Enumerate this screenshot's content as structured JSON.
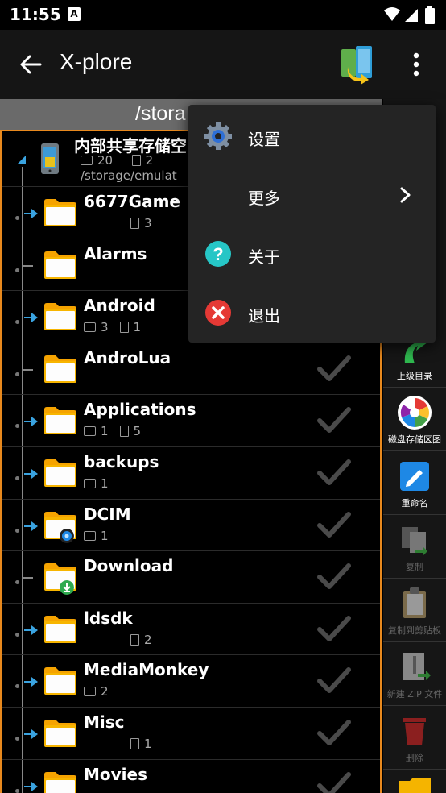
{
  "status_bar": {
    "time": "11:55",
    "badge": "A"
  },
  "action_bar": {
    "title": "X-plore"
  },
  "path_bar": {
    "path": "/stora"
  },
  "storage": {
    "name": "内部共享存储空",
    "folders": "20",
    "files": "2",
    "path": "/storage/emulat"
  },
  "rows": [
    {
      "name": "6677Game",
      "folders": "",
      "files": "3",
      "expandable": true,
      "checked": false
    },
    {
      "name": "Alarms",
      "folders": "",
      "files": "",
      "expandable": false,
      "checked": false
    },
    {
      "name": "Android",
      "folders": "3",
      "files": "1",
      "expandable": true,
      "checked": false
    },
    {
      "name": "AndroLua",
      "folders": "",
      "files": "",
      "expandable": false,
      "checked": true
    },
    {
      "name": "Applications",
      "folders": "1",
      "files": "5",
      "expandable": true,
      "checked": true
    },
    {
      "name": "backups",
      "folders": "1",
      "files": "",
      "expandable": true,
      "checked": true
    },
    {
      "name": "DCIM",
      "folders": "1",
      "files": "",
      "expandable": true,
      "checked": true
    },
    {
      "name": "Download",
      "folders": "",
      "files": "",
      "expandable": false,
      "checked": true
    },
    {
      "name": "ldsdk",
      "folders": "",
      "files": "2",
      "expandable": true,
      "checked": true
    },
    {
      "name": "MediaMonkey",
      "folders": "2",
      "files": "",
      "expandable": true,
      "checked": true
    },
    {
      "name": "Misc",
      "folders": "",
      "files": "1",
      "expandable": true,
      "checked": true
    },
    {
      "name": "Movies",
      "folders": "",
      "files": "",
      "expandable": true,
      "checked": true
    }
  ],
  "toolbar": {
    "parent_dir": "上级目录",
    "disk_map": "磁盘存储区图",
    "rename": "重命名",
    "copy": "复制",
    "copy_clipboard": "复制到剪贴板",
    "new_zip": "新建 ZIP 文件",
    "delete": "删除"
  },
  "menu": {
    "settings": "设置",
    "more": "更多",
    "about": "关于",
    "exit": "退出"
  },
  "colors": {
    "accent_orange": "#e8891e",
    "tree_blue": "#3aa3e0",
    "settings_blue": "#2e6fd6",
    "about_teal": "#26c6c6",
    "exit_red": "#e53935"
  }
}
